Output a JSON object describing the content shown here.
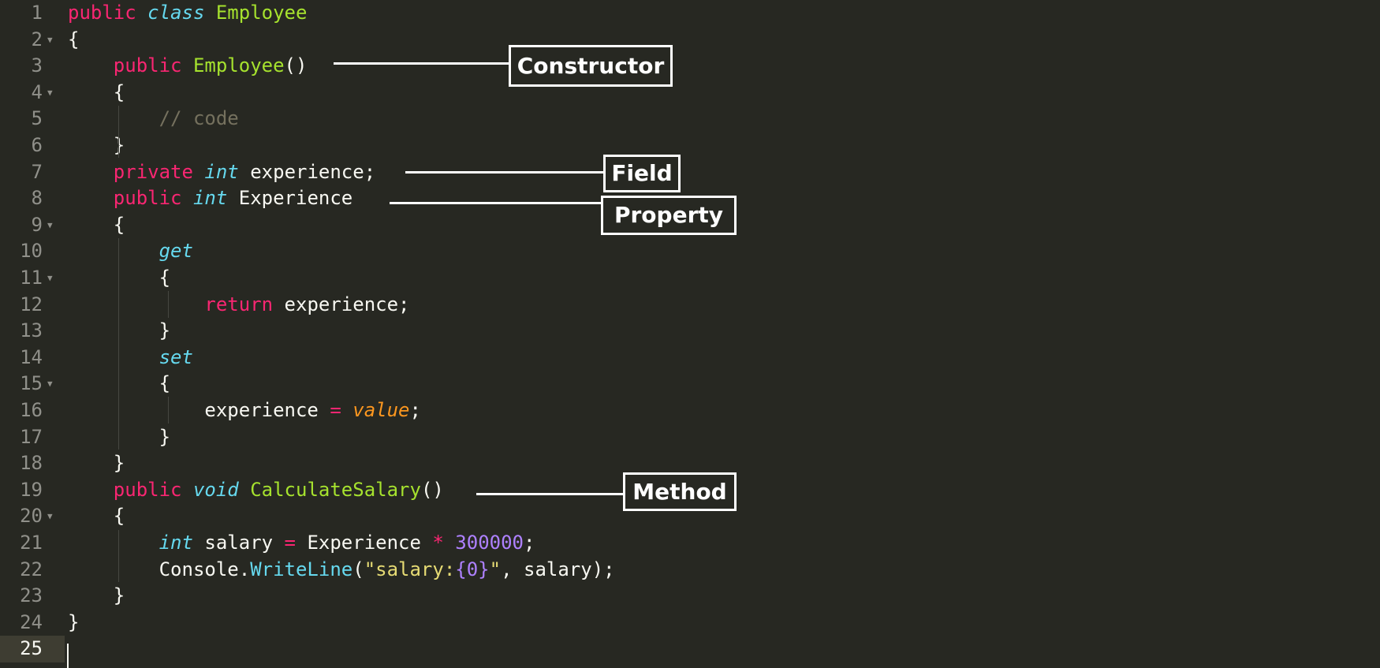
{
  "editor": {
    "line_numbers": [
      "1",
      "2",
      "3",
      "4",
      "5",
      "6",
      "7",
      "8",
      "9",
      "10",
      "11",
      "12",
      "13",
      "14",
      "15",
      "16",
      "17",
      "18",
      "19",
      "20",
      "21",
      "22",
      "23",
      "24",
      "25"
    ],
    "current_line": "25",
    "fold_marker": "▼",
    "lines": [
      {
        "tokens": [
          {
            "t": "public",
            "c": "kw"
          },
          {
            "t": " "
          },
          {
            "t": "class",
            "c": "st"
          },
          {
            "t": " "
          },
          {
            "t": "Employee",
            "c": "fn"
          }
        ]
      },
      {
        "tokens": [
          {
            "t": "{"
          }
        ]
      },
      {
        "tokens": [
          {
            "t": "    "
          },
          {
            "t": "public",
            "c": "kw"
          },
          {
            "t": " "
          },
          {
            "t": "Employee",
            "c": "fn"
          },
          {
            "t": "()"
          }
        ]
      },
      {
        "tokens": [
          {
            "t": "    {"
          }
        ]
      },
      {
        "tokens": [
          {
            "t": "        "
          },
          {
            "t": "// code",
            "c": "cm"
          }
        ]
      },
      {
        "tokens": [
          {
            "t": "    }"
          }
        ]
      },
      {
        "tokens": [
          {
            "t": "    "
          },
          {
            "t": "private",
            "c": "kw"
          },
          {
            "t": " "
          },
          {
            "t": "int",
            "c": "st"
          },
          {
            "t": " experience;"
          }
        ]
      },
      {
        "tokens": [
          {
            "t": "    "
          },
          {
            "t": "public",
            "c": "kw"
          },
          {
            "t": " "
          },
          {
            "t": "int",
            "c": "st"
          },
          {
            "t": " Experience"
          }
        ]
      },
      {
        "tokens": [
          {
            "t": "    {"
          }
        ]
      },
      {
        "tokens": [
          {
            "t": "        "
          },
          {
            "t": "get",
            "c": "st"
          }
        ]
      },
      {
        "tokens": [
          {
            "t": "        {"
          }
        ]
      },
      {
        "tokens": [
          {
            "t": "            "
          },
          {
            "t": "return",
            "c": "kw"
          },
          {
            "t": " experience;"
          }
        ]
      },
      {
        "tokens": [
          {
            "t": "        }"
          }
        ]
      },
      {
        "tokens": [
          {
            "t": "        "
          },
          {
            "t": "set",
            "c": "st"
          }
        ]
      },
      {
        "tokens": [
          {
            "t": "        {"
          }
        ]
      },
      {
        "tokens": [
          {
            "t": "            experience "
          },
          {
            "t": "=",
            "c": "kw"
          },
          {
            "t": " "
          },
          {
            "t": "value",
            "c": "prm"
          },
          {
            "t": ";"
          }
        ]
      },
      {
        "tokens": [
          {
            "t": "        }"
          }
        ]
      },
      {
        "tokens": [
          {
            "t": "    }"
          }
        ]
      },
      {
        "tokens": [
          {
            "t": "    "
          },
          {
            "t": "public",
            "c": "kw"
          },
          {
            "t": " "
          },
          {
            "t": "void",
            "c": "st"
          },
          {
            "t": " "
          },
          {
            "t": "CalculateSalary",
            "c": "fn"
          },
          {
            "t": "()"
          }
        ]
      },
      {
        "tokens": [
          {
            "t": "    {"
          }
        ]
      },
      {
        "tokens": [
          {
            "t": "        "
          },
          {
            "t": "int",
            "c": "st"
          },
          {
            "t": " salary "
          },
          {
            "t": "=",
            "c": "kw"
          },
          {
            "t": " Experience "
          },
          {
            "t": "*",
            "c": "kw"
          },
          {
            "t": " "
          },
          {
            "t": "300000",
            "c": "nm"
          },
          {
            "t": ";"
          }
        ]
      },
      {
        "tokens": [
          {
            "t": "        Console."
          },
          {
            "t": "WriteLine",
            "c": "sup"
          },
          {
            "t": "("
          },
          {
            "t": "\"salary:",
            "c": "str"
          },
          {
            "t": "{0}",
            "c": "nm"
          },
          {
            "t": "\"",
            "c": "str"
          },
          {
            "t": ", salary);"
          }
        ]
      },
      {
        "tokens": [
          {
            "t": "    }"
          }
        ]
      },
      {
        "tokens": [
          {
            "t": "}"
          }
        ]
      },
      {
        "tokens": []
      }
    ]
  },
  "annotations": {
    "constructor": "Constructor",
    "field": "Field",
    "property": "Property",
    "method": "Method"
  },
  "colors": {
    "background": "#272822",
    "keyword": "#f92672",
    "storage_type": "#66d9ef",
    "function_name": "#a6e22e",
    "comment": "#75715e",
    "number": "#ae81ff",
    "string": "#e6db74",
    "parameter": "#fd971f",
    "plain": "#f8f8f2",
    "callout": "#ffffff"
  }
}
